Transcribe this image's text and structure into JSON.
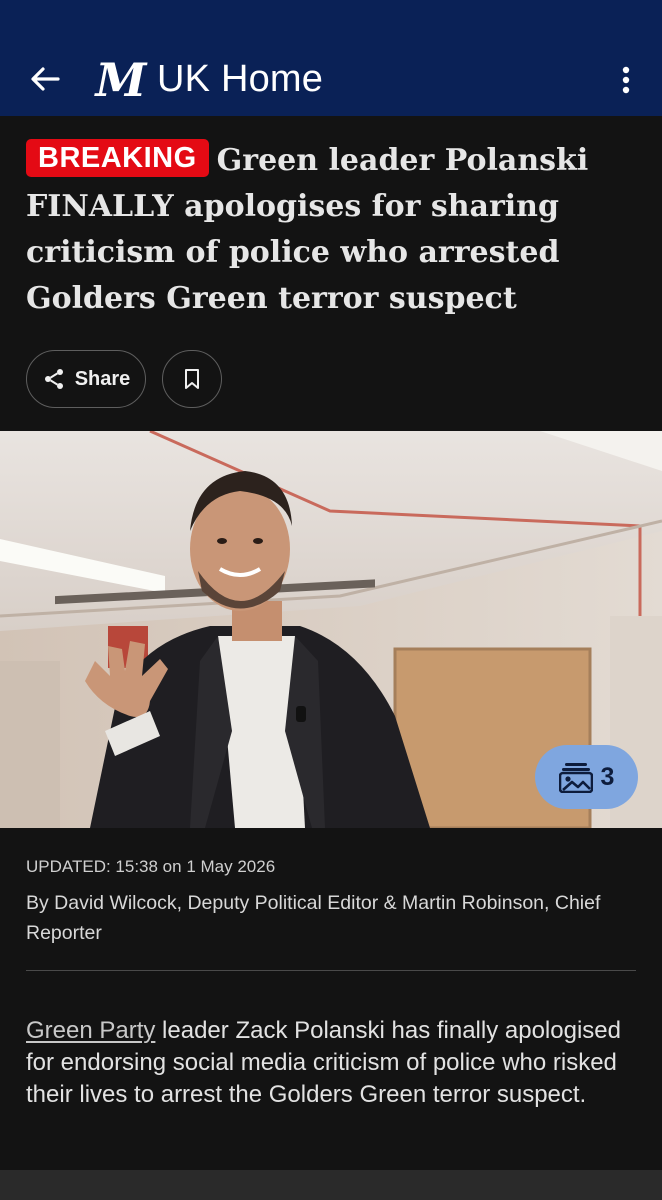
{
  "header": {
    "title": "UK Home",
    "logo_text": "M",
    "back_icon": "arrow-left-icon",
    "menu_icon": "more-vertical-icon",
    "background_color": "#0a2156"
  },
  "article": {
    "breaking_label": "BREAKING",
    "breaking_color": "#e40a14",
    "headline": "Green leader Polanski FINALLY apologises for sharing criticism of police who arrested Golders Green terror suspect",
    "share_label": "Share",
    "share_icon": "share-icon",
    "bookmark_icon": "bookmark-icon",
    "gallery_count": "3",
    "gallery_icon": "image-gallery-icon",
    "updated": "UPDATED: 15:38 on 1 May 2026",
    "byline": "By David Wilcock, Deputy Political Editor & Martin Robinson, Chief Reporter",
    "body_link": "Green Party",
    "body_rest": " leader Zack Polanski has finally apologised for endorsing social media criticism of police who risked their lives to arrest the Golders Green terror suspect."
  }
}
